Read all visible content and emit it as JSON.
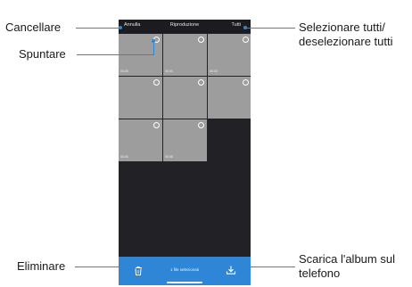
{
  "header": {
    "cancel_label": "Annulla",
    "title": "Riproduzione",
    "select_all_label": "Tutti"
  },
  "thumbnails": [
    {
      "duration": "00:05"
    },
    {
      "duration": "00:04"
    },
    {
      "duration": "00:03"
    },
    {
      "duration": ""
    },
    {
      "duration": ""
    },
    {
      "duration": ""
    },
    {
      "duration": "00:06"
    },
    {
      "duration": "00:05"
    }
  ],
  "bottom_bar": {
    "selected_count": "1 file selezionati",
    "delete_icon": "trash-icon",
    "download_icon": "download-icon"
  },
  "callouts": {
    "cancel": "Cancellare",
    "check": "Spuntare",
    "select_all_line1": "Selezionare tutti/",
    "select_all_line2": "deselezionare tutti",
    "delete": "Eliminare",
    "download_line1": "Scarica l'album sul",
    "download_line2": "telefono"
  },
  "colors": {
    "accent": "#2f86d6",
    "screen_bg": "#212126",
    "thumb": "#9d9d9d"
  }
}
